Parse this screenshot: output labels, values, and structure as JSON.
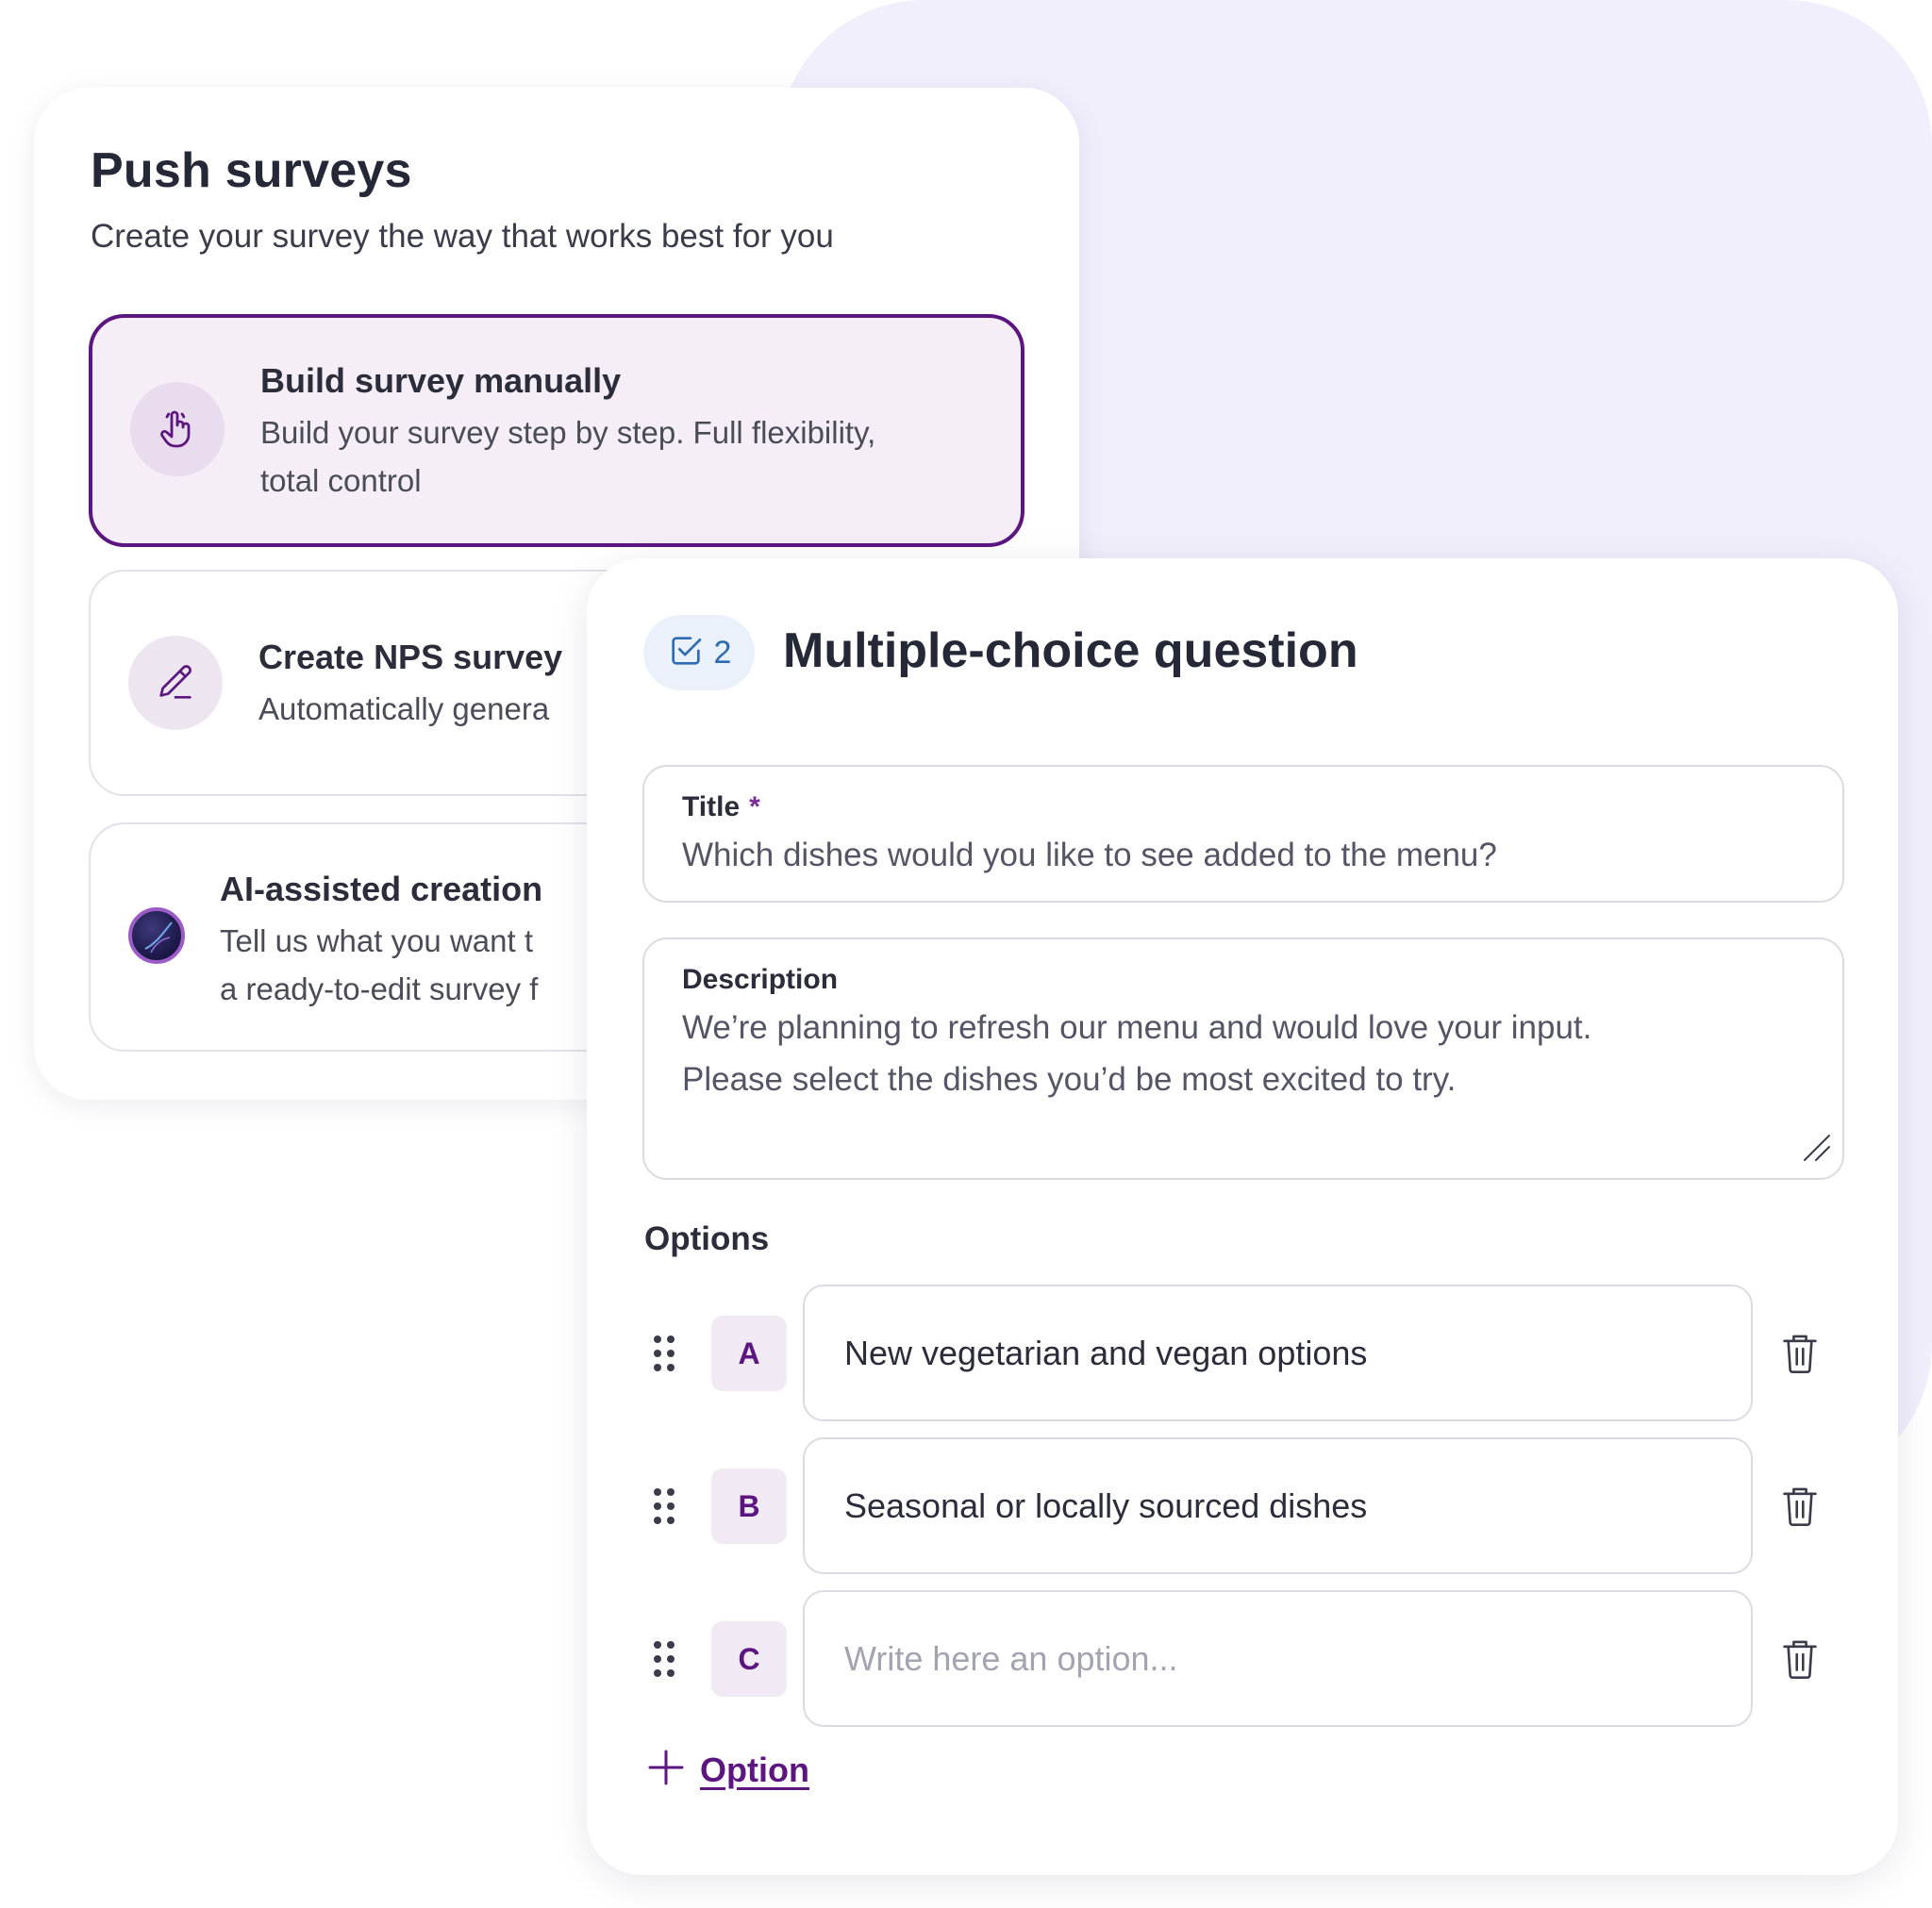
{
  "push": {
    "title": "Push surveys",
    "subtitle": "Create your survey the way that works best for you",
    "options": [
      {
        "icon": "pointer-hand-icon",
        "title": "Build survey manually",
        "desc_line1": "Build your survey step by step. Full flexibility,",
        "desc_line2": "total control",
        "selected": true
      },
      {
        "icon": "pencil-icon",
        "title": "Create NPS survey",
        "desc_line1": "Automatically genera"
      },
      {
        "icon": "ai-orb-icon",
        "title": "AI-assisted creation",
        "desc_line1": "Tell us what you want t",
        "desc_line2": "a ready-to-edit survey f"
      }
    ]
  },
  "question": {
    "badge_number": "2",
    "badge_icon": "checkbox-check-icon",
    "heading": "Multiple-choice question",
    "title_label": "Title",
    "title_required_mark": "*",
    "title_value": "Which dishes would you like to see added to the menu?",
    "description_label": "Description",
    "description_line1": "We’re planning to refresh our menu and would love your input.",
    "description_line2": "Please select the dishes you’d be most excited to try.",
    "options_heading": "Options",
    "options": [
      {
        "letter": "A",
        "value": "New vegetarian and vegan options",
        "placeholder": ""
      },
      {
        "letter": "B",
        "value": "Seasonal or locally sourced dishes",
        "placeholder": ""
      },
      {
        "letter": "C",
        "value": "",
        "placeholder": "Write here an option..."
      }
    ],
    "add_option_label": "Option"
  },
  "colors": {
    "accent": "#5c1680",
    "background_blob": "#f1effc",
    "badge_blue": "#2d6cb3"
  }
}
